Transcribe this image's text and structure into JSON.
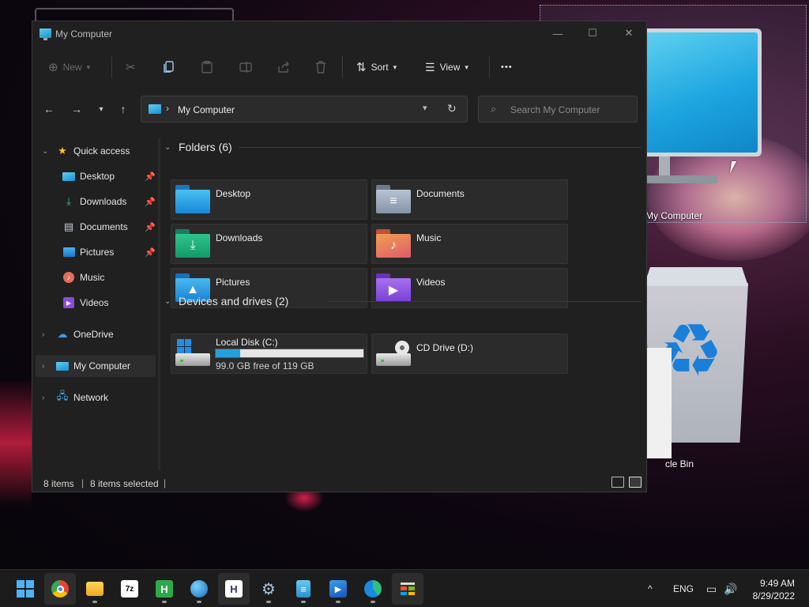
{
  "desktop": {
    "my_computer_label": "My Computer",
    "recycle_bin_label": "cle Bin"
  },
  "window": {
    "title": "My Computer",
    "controls": {
      "minimize": "—",
      "maximize": "☐",
      "close": "✕"
    }
  },
  "toolbar": {
    "new_label": "New",
    "sort_label": "Sort",
    "view_label": "View",
    "more_label": "•••"
  },
  "address": {
    "path_label": "My Computer",
    "search_placeholder": "Search My Computer"
  },
  "sidebar": {
    "quick_access": "Quick access",
    "items": [
      {
        "label": "Desktop",
        "icon": "desktop-icon",
        "pinned": true
      },
      {
        "label": "Downloads",
        "icon": "downloads-icon",
        "pinned": true
      },
      {
        "label": "Documents",
        "icon": "documents-icon",
        "pinned": true
      },
      {
        "label": "Pictures",
        "icon": "pictures-icon",
        "pinned": true
      },
      {
        "label": "Music",
        "icon": "music-icon",
        "pinned": false
      },
      {
        "label": "Videos",
        "icon": "videos-icon",
        "pinned": false
      }
    ],
    "onedrive": "OneDrive",
    "my_computer": "My Computer",
    "network": "Network"
  },
  "content": {
    "folders_header": "Folders (6)",
    "folders": [
      {
        "label": "Desktop",
        "color": "#1e90d6"
      },
      {
        "label": "Documents",
        "color": "#8a9bb0"
      },
      {
        "label": "Downloads",
        "color": "#1aa37a"
      },
      {
        "label": "Music",
        "color": "#e06a4a"
      },
      {
        "label": "Pictures",
        "color": "#2a9ee0"
      },
      {
        "label": "Videos",
        "color": "#8a4ad8"
      }
    ],
    "devices_header": "Devices and drives (2)",
    "drives": [
      {
        "label": "Local Disk (C:)",
        "free_text": "99.0 GB free of 119 GB",
        "used_fraction": 0.168
      },
      {
        "label": "CD Drive (D:)"
      }
    ]
  },
  "status": {
    "items_count": "8 items",
    "selected_count": "8 items selected"
  },
  "taskbar": {
    "apps": [
      "start",
      "chrome",
      "file-explorer",
      "7zip",
      "h-app",
      "network-app",
      "hxd",
      "settings",
      "notepad",
      "media-player",
      "edge",
      "store"
    ],
    "language": "ENG",
    "time": "9:49 AM",
    "date": "8/29/2022"
  }
}
